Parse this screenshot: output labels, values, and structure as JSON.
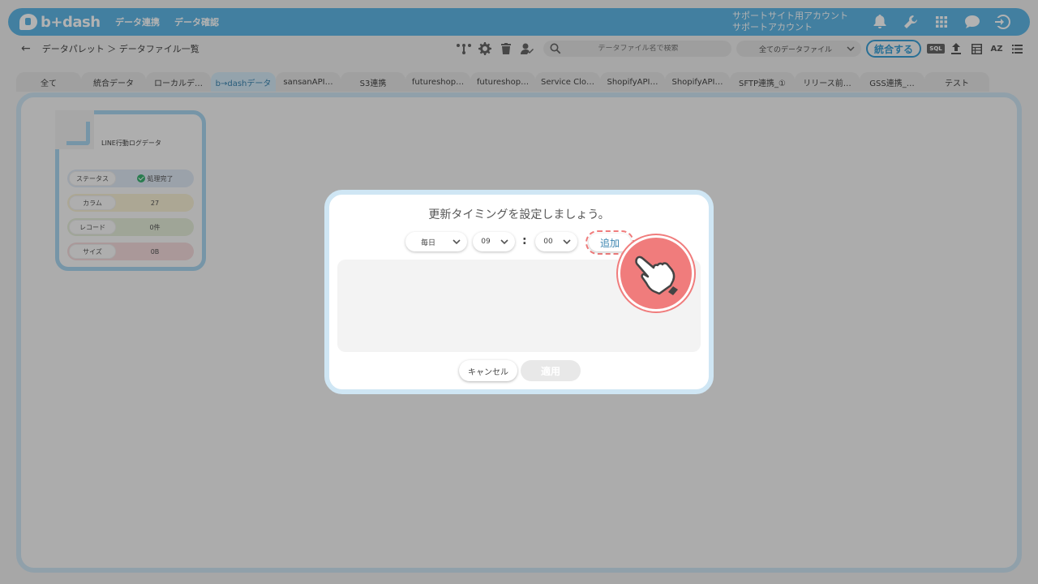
{
  "header": {
    "logo_text": "b+dash",
    "nav": [
      "データ連携",
      "データ確認"
    ],
    "account_line1": "サポートサイト用アカウント",
    "account_line2": "サポートアカウント"
  },
  "toolbar": {
    "breadcrumb": "データパレット ＞ データファイル一覧",
    "search_placeholder": "データファイル名で検索",
    "filter_value": "全てのデータファイル",
    "merge_label": "統合する",
    "sql_label": "SQL",
    "sort_label": "AZ"
  },
  "tabs": [
    "全て",
    "統合データ",
    "ローカルデ…",
    "b→dashデータ",
    "sansanAPI…",
    "S3連携",
    "futureshop…",
    "futureshop…",
    "Service Clo…",
    "ShopifyAPI…",
    "ShopifyAPI…",
    "SFTP連携_①",
    "リリース前…",
    "GSS連携_…",
    "テスト"
  ],
  "card": {
    "title": "LINE行動ログデータ",
    "status_label": "ステータス",
    "status_value": "処理完了",
    "column_label": "カラム",
    "column_value": "27",
    "record_label": "レコード",
    "record_value": "0件",
    "size_label": "サイズ",
    "size_value": "0B"
  },
  "modal": {
    "title": "更新タイミングを設定しましょう。",
    "frequency": "毎日",
    "hour": "09",
    "colon": ":",
    "minute": "00",
    "add_label": "追加",
    "cancel_label": "キャンセル",
    "apply_label": "適用"
  },
  "colors": {
    "brand": "#5fb7e5",
    "accent": "#3a9fd6",
    "highlight": "#f07c7c",
    "success": "#3bb273"
  }
}
